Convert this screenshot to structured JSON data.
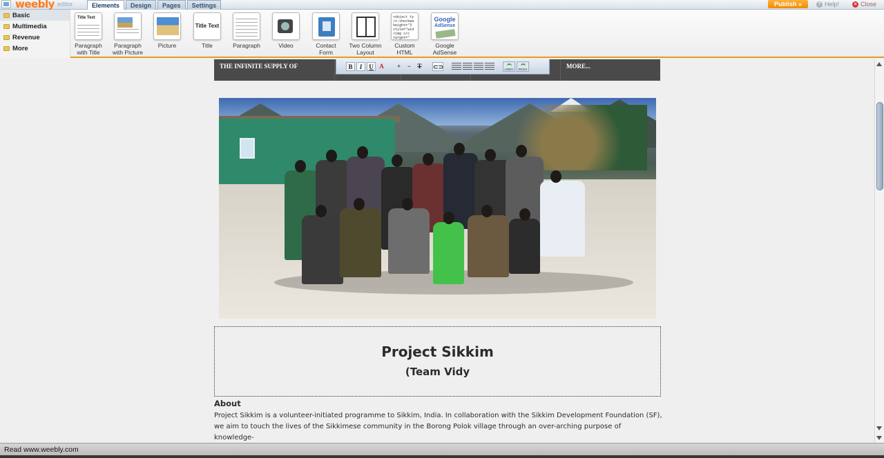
{
  "app": {
    "logo": "weebly",
    "logo_sub": "editor",
    "tabs": [
      "Elements",
      "Design",
      "Pages",
      "Settings"
    ],
    "active_tab": "Elements",
    "publish_label": "Publish »",
    "help_label": "Help!",
    "close_label": "Close"
  },
  "categories": [
    "Basic",
    "Multimedia",
    "Revenue",
    "More"
  ],
  "elements": [
    {
      "label_line1": "Paragraph",
      "label_line2": "with Title",
      "icon": "paragraph-title-icon",
      "thumb_title": "Title Text"
    },
    {
      "label_line1": "Paragraph",
      "label_line2": "with Picture",
      "icon": "paragraph-picture-icon"
    },
    {
      "label_line1": "Picture",
      "label_line2": "",
      "icon": "picture-icon"
    },
    {
      "label_line1": "Title",
      "label_line2": "",
      "icon": "title-icon",
      "thumb_title": "Title Text"
    },
    {
      "label_line1": "Paragraph",
      "label_line2": "",
      "icon": "paragraph-icon"
    },
    {
      "label_line1": "Video",
      "label_line2": "",
      "icon": "video-icon"
    },
    {
      "label_line1": "Contact",
      "label_line2": "Form",
      "icon": "contact-form-icon"
    },
    {
      "label_line1": "Two Column",
      "label_line2": "Layout",
      "icon": "two-column-icon"
    },
    {
      "label_line1": "Custom",
      "label_line2": "HTML",
      "icon": "custom-html-icon",
      "thumb_code": "<object ty\n/x-shockwa\nheight=\"3\nstyle=\"wid\n<img src\ntarget=\"_"
    },
    {
      "label_line1": "Google",
      "label_line2": "AdSense",
      "icon": "adsense-icon",
      "thumb_title": "Google",
      "thumb_sub": "AdSense"
    }
  ],
  "site_nav": {
    "items": [
      "THE INFINITE SUPPLY OF",
      "MORE..."
    ]
  },
  "format_toolbar": {
    "bold": "B",
    "italic": "I",
    "underline": "U",
    "color": "A",
    "plus": "+",
    "minus": "−",
    "clear": "T",
    "undo": "UNDO",
    "redo": "REDO"
  },
  "page": {
    "title": "Project Sikkim",
    "subtitle": "(Team Vidy",
    "about_heading": "About",
    "about_text": "Project Sikkim is a volunteer-initiated programme to Sikkim, India. In collaboration with the Sikkim Development Foundation (SF), we aim to touch the lives of the Sikkimese community in the Borong Polok village through an over-arching purpose of knowledge-"
  },
  "status_bar": {
    "text": "Read www.weebly.com"
  },
  "colors": {
    "accent": "#e99a1f",
    "nav_bg": "#4a4a4a",
    "publish": "#f18a00"
  }
}
